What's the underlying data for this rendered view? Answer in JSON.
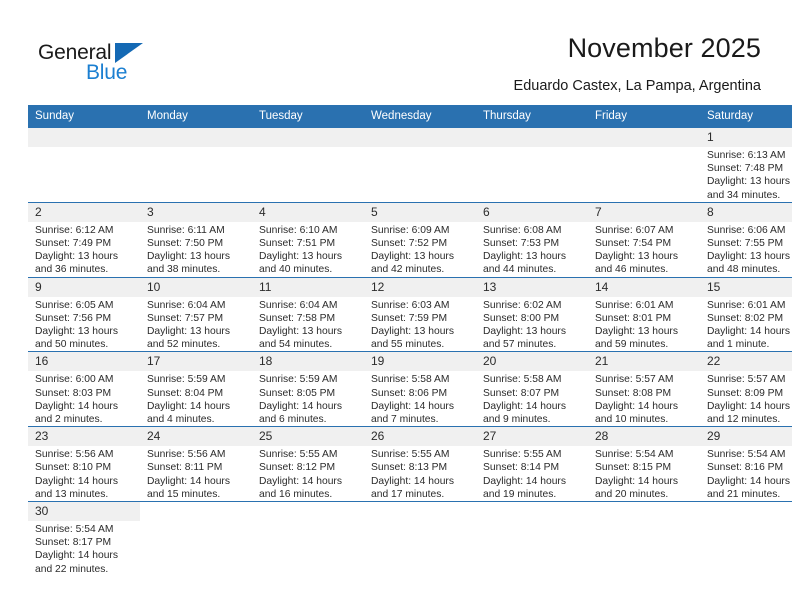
{
  "brand": {
    "logo_text_1": "General",
    "logo_text_2": "Blue",
    "logo_color_dark": "#1a1a1a",
    "logo_color_blue": "#1b7fd1"
  },
  "header": {
    "title": "November 2025",
    "subtitle": "Eduardo Castex, La Pampa, Argentina"
  },
  "theme": {
    "header_bg": "#2a71b0",
    "header_text": "#ffffff",
    "daynum_bg": "#f0f0f0",
    "row_divider": "#2a71b0",
    "body_text": "#2b2b2b"
  },
  "weekdays": [
    "Sunday",
    "Monday",
    "Tuesday",
    "Wednesday",
    "Thursday",
    "Friday",
    "Saturday"
  ],
  "weeks": [
    [
      {
        "day": "",
        "blank": true
      },
      {
        "day": "",
        "blank": true
      },
      {
        "day": "",
        "blank": true
      },
      {
        "day": "",
        "blank": true
      },
      {
        "day": "",
        "blank": true
      },
      {
        "day": "",
        "blank": true
      },
      {
        "day": "1",
        "sunrise": "Sunrise: 6:13 AM",
        "sunset": "Sunset: 7:48 PM",
        "daylight_1": "Daylight: 13 hours",
        "daylight_2": "and 34 minutes."
      }
    ],
    [
      {
        "day": "2",
        "sunrise": "Sunrise: 6:12 AM",
        "sunset": "Sunset: 7:49 PM",
        "daylight_1": "Daylight: 13 hours",
        "daylight_2": "and 36 minutes."
      },
      {
        "day": "3",
        "sunrise": "Sunrise: 6:11 AM",
        "sunset": "Sunset: 7:50 PM",
        "daylight_1": "Daylight: 13 hours",
        "daylight_2": "and 38 minutes."
      },
      {
        "day": "4",
        "sunrise": "Sunrise: 6:10 AM",
        "sunset": "Sunset: 7:51 PM",
        "daylight_1": "Daylight: 13 hours",
        "daylight_2": "and 40 minutes."
      },
      {
        "day": "5",
        "sunrise": "Sunrise: 6:09 AM",
        "sunset": "Sunset: 7:52 PM",
        "daylight_1": "Daylight: 13 hours",
        "daylight_2": "and 42 minutes."
      },
      {
        "day": "6",
        "sunrise": "Sunrise: 6:08 AM",
        "sunset": "Sunset: 7:53 PM",
        "daylight_1": "Daylight: 13 hours",
        "daylight_2": "and 44 minutes."
      },
      {
        "day": "7",
        "sunrise": "Sunrise: 6:07 AM",
        "sunset": "Sunset: 7:54 PM",
        "daylight_1": "Daylight: 13 hours",
        "daylight_2": "and 46 minutes."
      },
      {
        "day": "8",
        "sunrise": "Sunrise: 6:06 AM",
        "sunset": "Sunset: 7:55 PM",
        "daylight_1": "Daylight: 13 hours",
        "daylight_2": "and 48 minutes."
      }
    ],
    [
      {
        "day": "9",
        "sunrise": "Sunrise: 6:05 AM",
        "sunset": "Sunset: 7:56 PM",
        "daylight_1": "Daylight: 13 hours",
        "daylight_2": "and 50 minutes."
      },
      {
        "day": "10",
        "sunrise": "Sunrise: 6:04 AM",
        "sunset": "Sunset: 7:57 PM",
        "daylight_1": "Daylight: 13 hours",
        "daylight_2": "and 52 minutes."
      },
      {
        "day": "11",
        "sunrise": "Sunrise: 6:04 AM",
        "sunset": "Sunset: 7:58 PM",
        "daylight_1": "Daylight: 13 hours",
        "daylight_2": "and 54 minutes."
      },
      {
        "day": "12",
        "sunrise": "Sunrise: 6:03 AM",
        "sunset": "Sunset: 7:59 PM",
        "daylight_1": "Daylight: 13 hours",
        "daylight_2": "and 55 minutes."
      },
      {
        "day": "13",
        "sunrise": "Sunrise: 6:02 AM",
        "sunset": "Sunset: 8:00 PM",
        "daylight_1": "Daylight: 13 hours",
        "daylight_2": "and 57 minutes."
      },
      {
        "day": "14",
        "sunrise": "Sunrise: 6:01 AM",
        "sunset": "Sunset: 8:01 PM",
        "daylight_1": "Daylight: 13 hours",
        "daylight_2": "and 59 minutes."
      },
      {
        "day": "15",
        "sunrise": "Sunrise: 6:01 AM",
        "sunset": "Sunset: 8:02 PM",
        "daylight_1": "Daylight: 14 hours",
        "daylight_2": "and 1 minute."
      }
    ],
    [
      {
        "day": "16",
        "sunrise": "Sunrise: 6:00 AM",
        "sunset": "Sunset: 8:03 PM",
        "daylight_1": "Daylight: 14 hours",
        "daylight_2": "and 2 minutes."
      },
      {
        "day": "17",
        "sunrise": "Sunrise: 5:59 AM",
        "sunset": "Sunset: 8:04 PM",
        "daylight_1": "Daylight: 14 hours",
        "daylight_2": "and 4 minutes."
      },
      {
        "day": "18",
        "sunrise": "Sunrise: 5:59 AM",
        "sunset": "Sunset: 8:05 PM",
        "daylight_1": "Daylight: 14 hours",
        "daylight_2": "and 6 minutes."
      },
      {
        "day": "19",
        "sunrise": "Sunrise: 5:58 AM",
        "sunset": "Sunset: 8:06 PM",
        "daylight_1": "Daylight: 14 hours",
        "daylight_2": "and 7 minutes."
      },
      {
        "day": "20",
        "sunrise": "Sunrise: 5:58 AM",
        "sunset": "Sunset: 8:07 PM",
        "daylight_1": "Daylight: 14 hours",
        "daylight_2": "and 9 minutes."
      },
      {
        "day": "21",
        "sunrise": "Sunrise: 5:57 AM",
        "sunset": "Sunset: 8:08 PM",
        "daylight_1": "Daylight: 14 hours",
        "daylight_2": "and 10 minutes."
      },
      {
        "day": "22",
        "sunrise": "Sunrise: 5:57 AM",
        "sunset": "Sunset: 8:09 PM",
        "daylight_1": "Daylight: 14 hours",
        "daylight_2": "and 12 minutes."
      }
    ],
    [
      {
        "day": "23",
        "sunrise": "Sunrise: 5:56 AM",
        "sunset": "Sunset: 8:10 PM",
        "daylight_1": "Daylight: 14 hours",
        "daylight_2": "and 13 minutes."
      },
      {
        "day": "24",
        "sunrise": "Sunrise: 5:56 AM",
        "sunset": "Sunset: 8:11 PM",
        "daylight_1": "Daylight: 14 hours",
        "daylight_2": "and 15 minutes."
      },
      {
        "day": "25",
        "sunrise": "Sunrise: 5:55 AM",
        "sunset": "Sunset: 8:12 PM",
        "daylight_1": "Daylight: 14 hours",
        "daylight_2": "and 16 minutes."
      },
      {
        "day": "26",
        "sunrise": "Sunrise: 5:55 AM",
        "sunset": "Sunset: 8:13 PM",
        "daylight_1": "Daylight: 14 hours",
        "daylight_2": "and 17 minutes."
      },
      {
        "day": "27",
        "sunrise": "Sunrise: 5:55 AM",
        "sunset": "Sunset: 8:14 PM",
        "daylight_1": "Daylight: 14 hours",
        "daylight_2": "and 19 minutes."
      },
      {
        "day": "28",
        "sunrise": "Sunrise: 5:54 AM",
        "sunset": "Sunset: 8:15 PM",
        "daylight_1": "Daylight: 14 hours",
        "daylight_2": "and 20 minutes."
      },
      {
        "day": "29",
        "sunrise": "Sunrise: 5:54 AM",
        "sunset": "Sunset: 8:16 PM",
        "daylight_1": "Daylight: 14 hours",
        "daylight_2": "and 21 minutes."
      }
    ],
    [
      {
        "day": "30",
        "sunrise": "Sunrise: 5:54 AM",
        "sunset": "Sunset: 8:17 PM",
        "daylight_1": "Daylight: 14 hours",
        "daylight_2": "and 22 minutes."
      },
      {
        "day": "",
        "blank": true
      },
      {
        "day": "",
        "blank": true
      },
      {
        "day": "",
        "blank": true
      },
      {
        "day": "",
        "blank": true
      },
      {
        "day": "",
        "blank": true
      },
      {
        "day": "",
        "blank": true
      }
    ]
  ]
}
